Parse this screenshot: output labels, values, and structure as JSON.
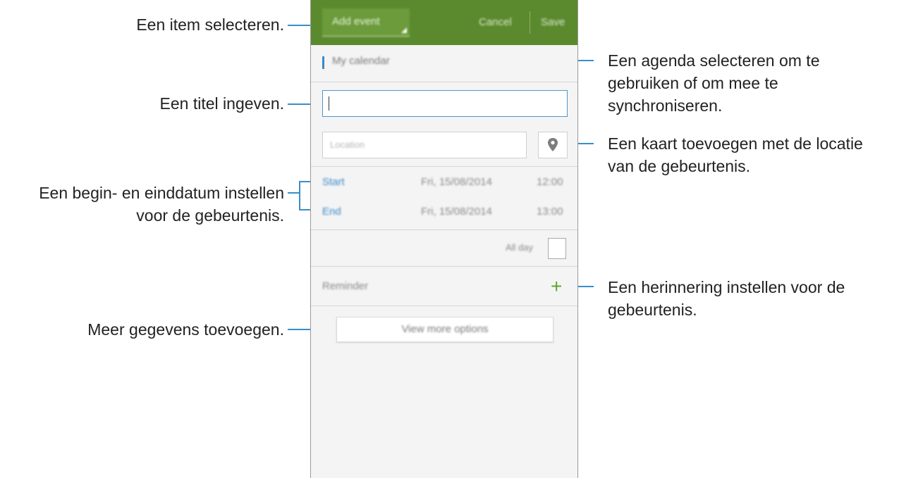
{
  "annotations": {
    "select_item": "Een item selecteren.",
    "enter_title": "Een titel ingeven.",
    "set_dates_line1": "Een begin- en einddatum instellen",
    "set_dates_line2": "voor de gebeurtenis.",
    "more_details": "Meer gegevens toevoegen.",
    "select_calendar_line1": "Een agenda selecteren om te",
    "select_calendar_line2": "gebruiken of om mee te",
    "select_calendar_line3": "synchroniseren.",
    "add_map_line1": "Een kaart toevoegen met de locatie",
    "add_map_line2": "van de gebeurtenis.",
    "set_reminder_line1": "Een herinnering instellen voor de",
    "set_reminder_line2": "gebeurtenis."
  },
  "phone": {
    "actionbar": {
      "spinner": "Add event",
      "cancel": "Cancel",
      "save": "Save"
    },
    "calendar": "My calendar",
    "location_placeholder": "Location",
    "start": {
      "label": "Start",
      "date": "Fri, 15/08/2014",
      "time": "12:00"
    },
    "end": {
      "label": "End",
      "date": "Fri, 15/08/2014",
      "time": "13:00"
    },
    "all_day": "All day",
    "reminder": "Reminder",
    "more_options": "View more options",
    "icons": {
      "map": "map-pin-icon",
      "add": "plus-icon"
    }
  },
  "colors": {
    "accent_green": "#5b8a2e",
    "leader_blue": "#3a8ec9",
    "date_blue": "#3b89c7",
    "plus_green": "#5aa832"
  }
}
